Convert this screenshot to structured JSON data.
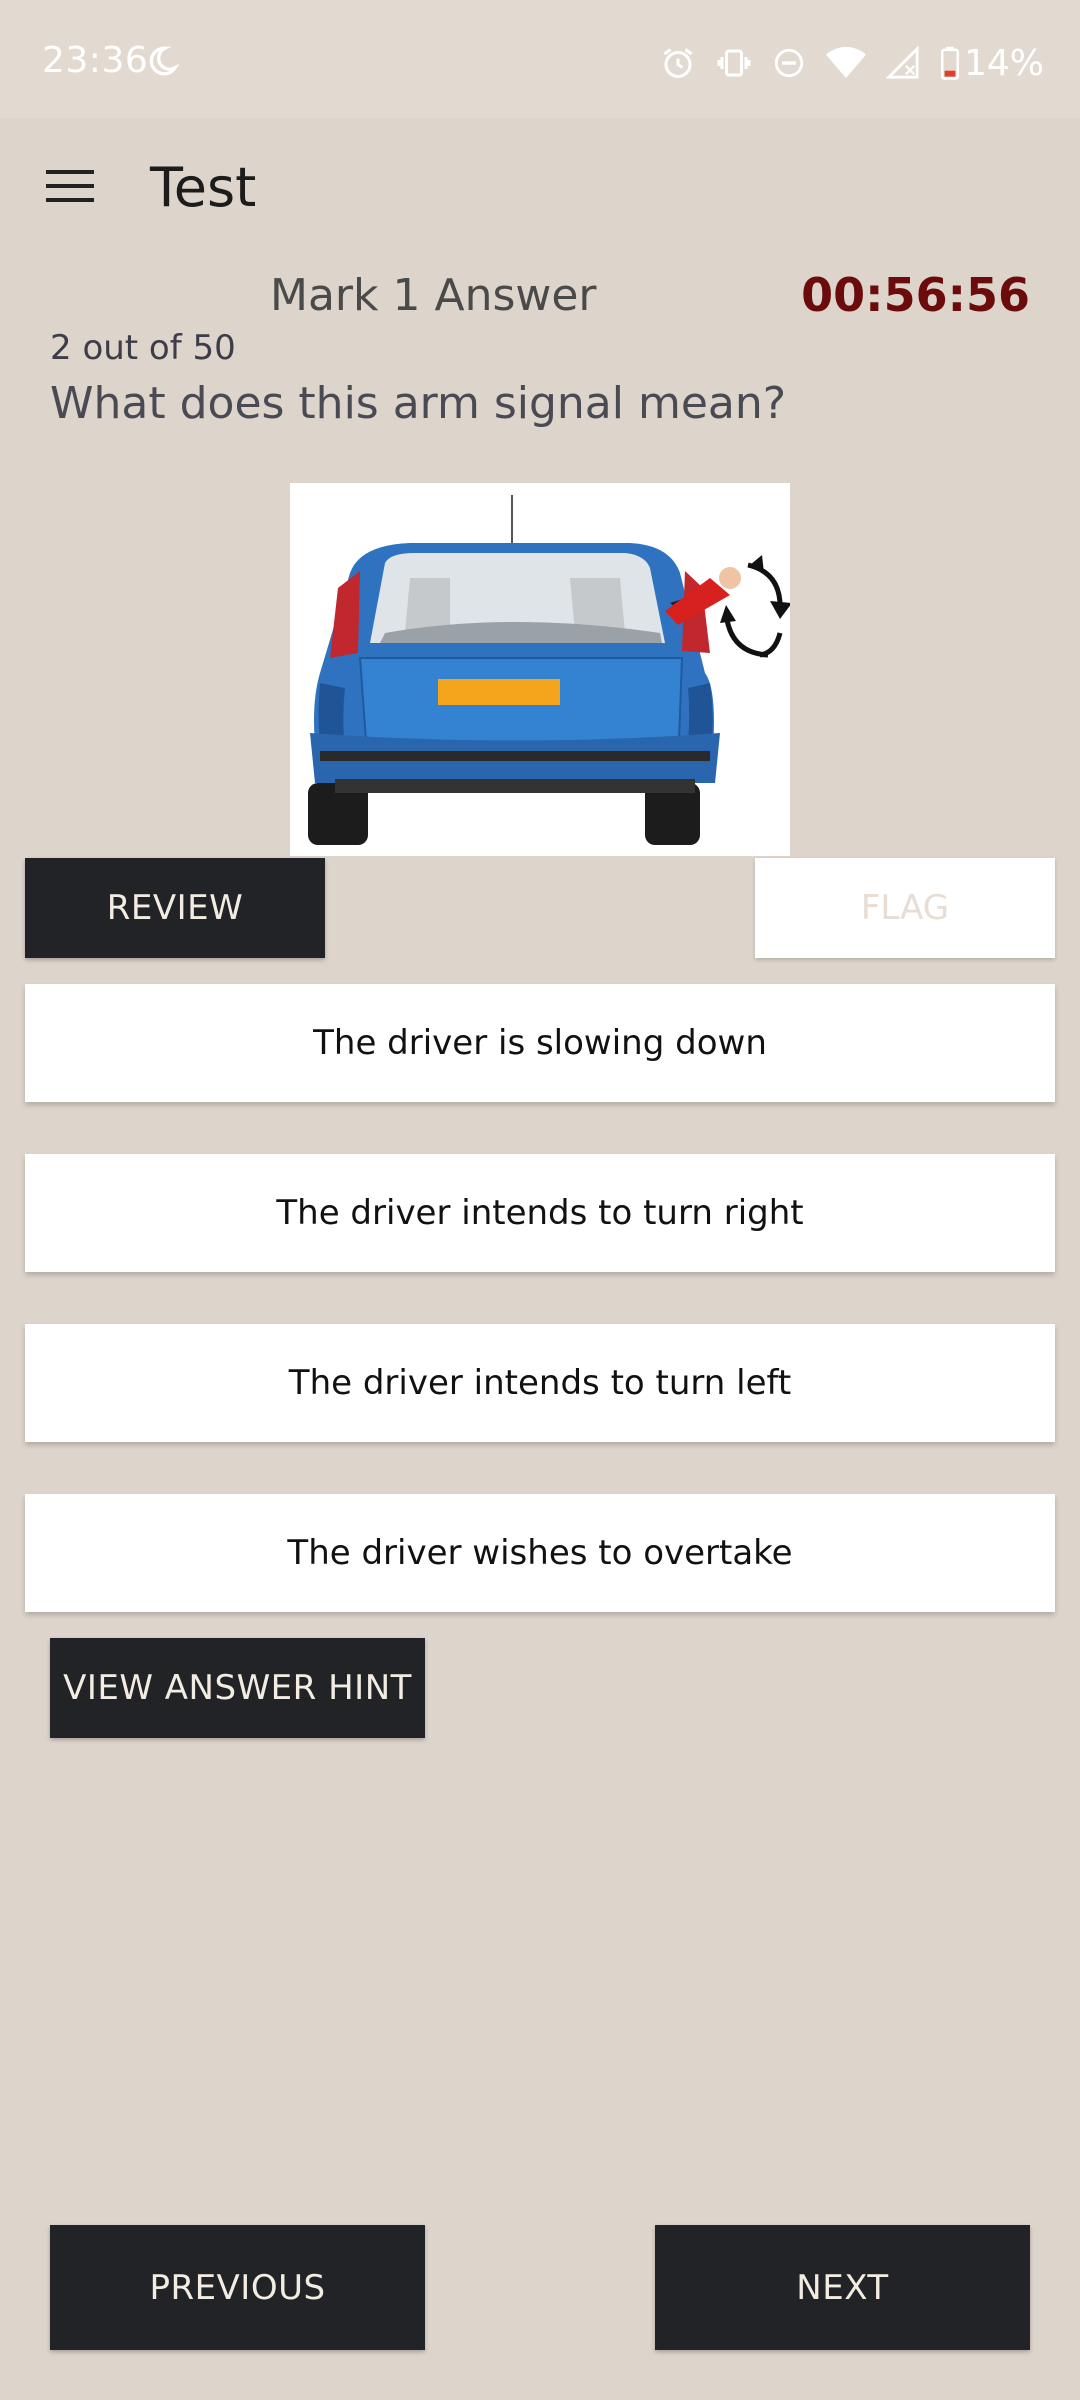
{
  "status_bar": {
    "time": "23:36",
    "battery_text": "14%",
    "icons": [
      "moon-icon",
      "alarm-icon",
      "vibrate-icon",
      "do-not-disturb-icon",
      "wifi-icon",
      "signal-icon",
      "battery-icon"
    ]
  },
  "app_bar": {
    "title": "Test",
    "menu_icon": "hamburger-menu-icon"
  },
  "quiz": {
    "mark_label": "Mark 1 Answer",
    "timer": "00:56:56",
    "progress": "2 out of 50",
    "question": "What does this arm signal mean?",
    "image": "car-arm-signal-illustration"
  },
  "actions": {
    "review": "REVIEW",
    "flag": "FLAG"
  },
  "answers": [
    "The driver is slowing down",
    "The driver intends to turn right",
    "The driver intends to turn left",
    "The driver wishes to overtake"
  ],
  "hint": "VIEW ANSWER HINT",
  "nav": {
    "previous": "PREVIOUS",
    "next": "NEXT"
  },
  "colors": {
    "background": "#ddd5cc",
    "dark_button": "#212326",
    "timer": "#6b0b0b",
    "car_blue": "#2f73c0",
    "plate_orange": "#f5a51b",
    "sleeve_red": "#d8201f"
  }
}
